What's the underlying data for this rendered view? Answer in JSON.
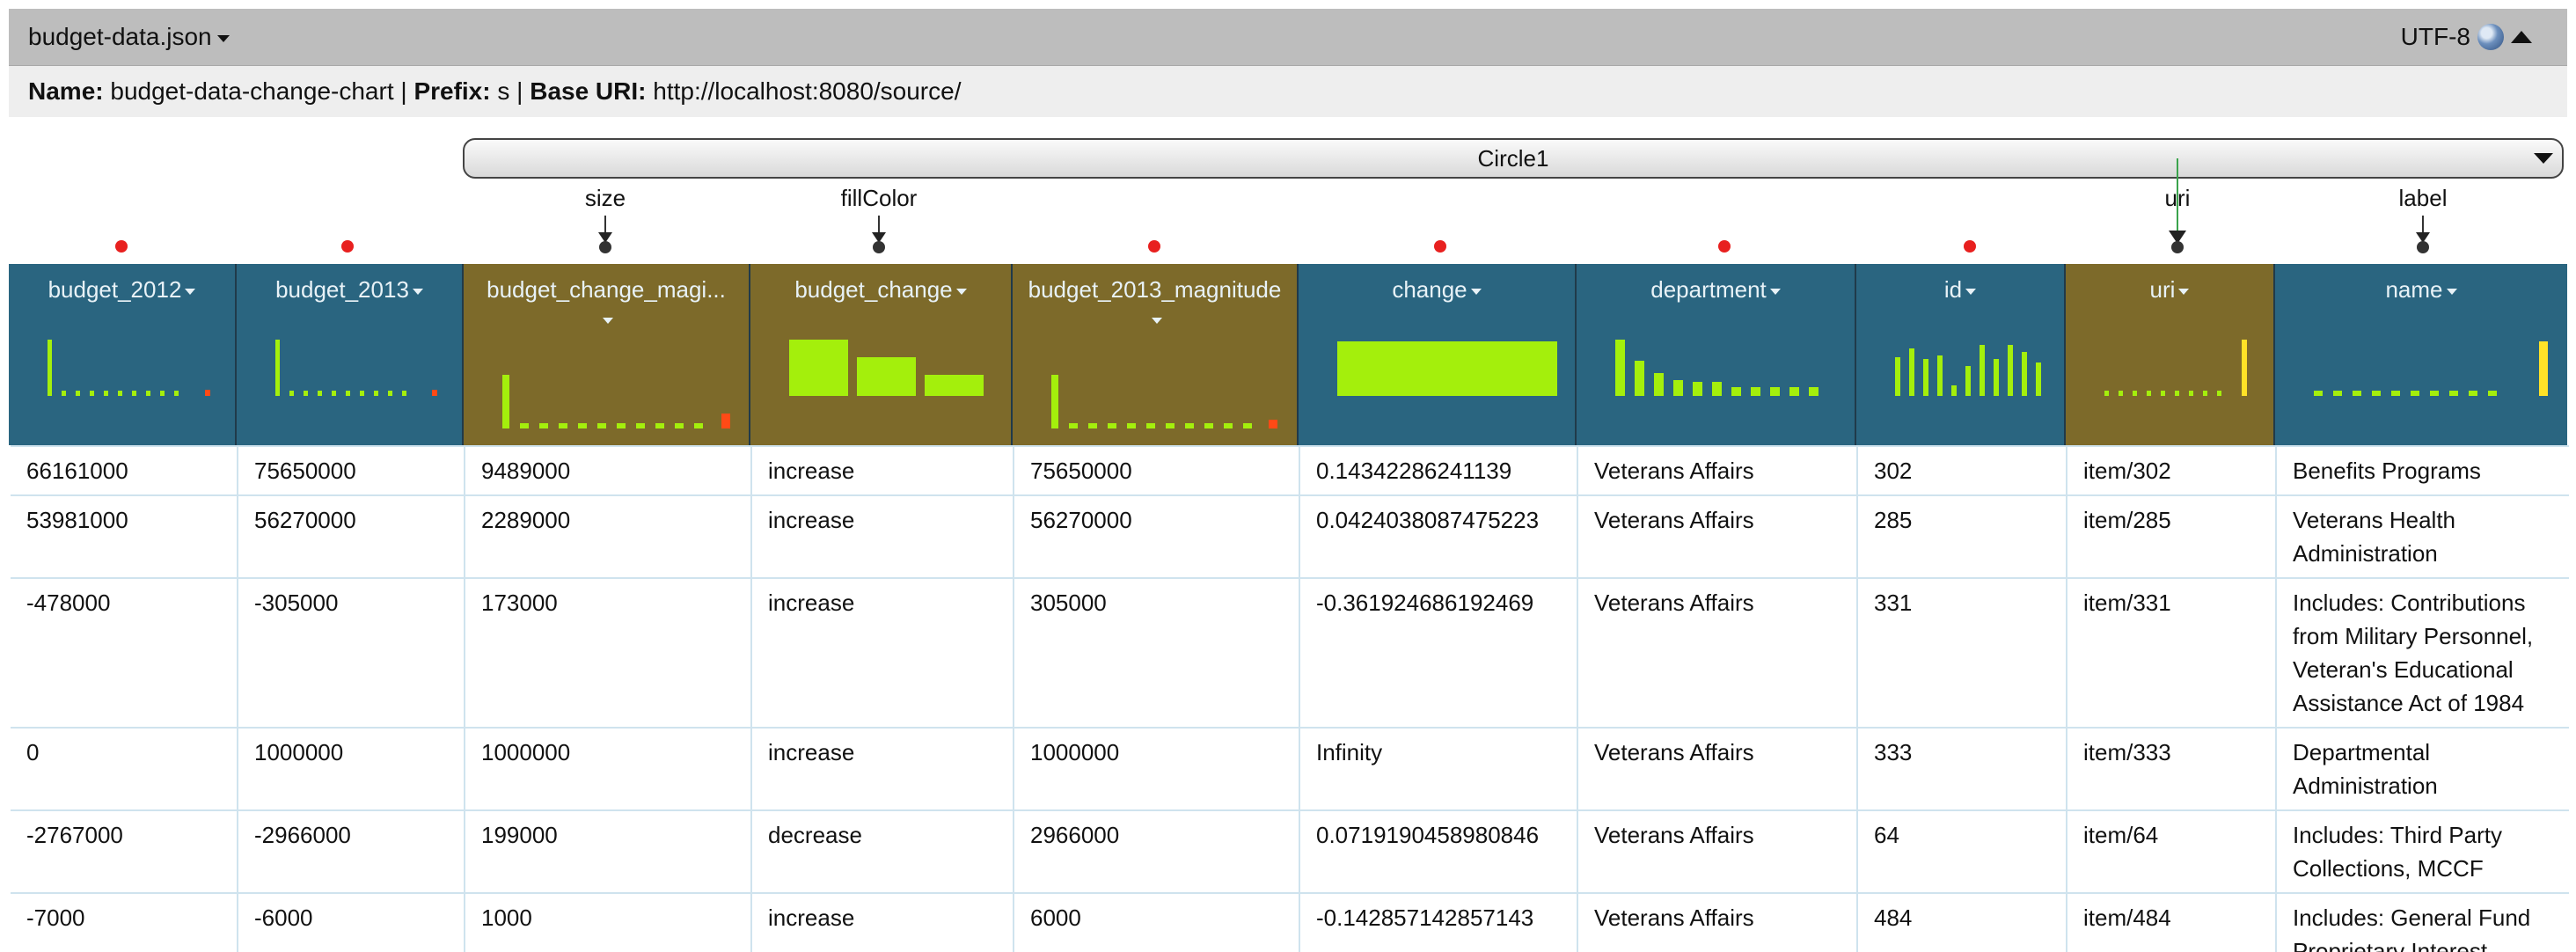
{
  "header": {
    "file_title": "budget-data.json",
    "encoding": "UTF-8",
    "name_label": "Name:",
    "name_value": "budget-data-change-chart",
    "prefix_label": "Prefix:",
    "prefix_value": "s",
    "base_uri_label": "Base URI:",
    "base_uri_value": "http://localhost:8080/source/",
    "icons": [
      "dropdown-caret-icon",
      "globe-icon",
      "collapse-chevron-up-icon"
    ]
  },
  "mark": {
    "selected": "Circle1",
    "properties": [
      "size",
      "fillColor",
      "uri",
      "label"
    ]
  },
  "colors": {
    "header_blue": "#2a6580",
    "header_olive": "#7d6a2a",
    "bar_green": "#a4ef0c",
    "bar_orange": "#ff4a16",
    "bar_yellow": "#ffe227",
    "dot_red": "#e8201f"
  },
  "columns": [
    "budget_2012",
    "budget_2013",
    "budget_change_magi...",
    "budget_change",
    "budget_2013_magnitude",
    "change",
    "department",
    "id",
    "uri",
    "name"
  ],
  "rows": [
    [
      "66161000",
      "75650000",
      "9489000",
      "increase",
      "75650000",
      "0.14342286241139",
      "Veterans Affairs",
      "302",
      "item/302",
      "Benefits Programs"
    ],
    [
      "53981000",
      "56270000",
      "2289000",
      "increase",
      "56270000",
      "0.0424038087475223",
      "Veterans Affairs",
      "285",
      "item/285",
      "Veterans Health Administration"
    ],
    [
      "-478000",
      "-305000",
      "173000",
      "increase",
      "305000",
      "-0.361924686192469",
      "Veterans Affairs",
      "331",
      "item/331",
      "Includes: Contributions from Military Personnel, Veteran's Educational Assistance Act of 1984"
    ],
    [
      "0",
      "1000000",
      "1000000",
      "increase",
      "1000000",
      "Infinity",
      "Veterans Affairs",
      "333",
      "item/333",
      "Departmental Administration"
    ],
    [
      "-2767000",
      "-2966000",
      "199000",
      "decrease",
      "2966000",
      "0.0719190458980846",
      "Veterans Affairs",
      "64",
      "item/64",
      "Includes: Third Party Collections, MCCF"
    ],
    [
      "-7000",
      "-6000",
      "1000",
      "increase",
      "6000",
      "-0.142857142857143",
      "Veterans Affairs",
      "484",
      "item/484",
      "Includes: General Fund Proprietary Interest"
    ]
  ]
}
